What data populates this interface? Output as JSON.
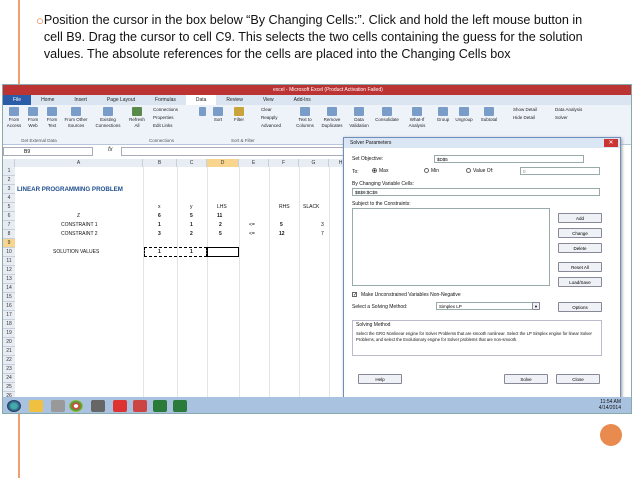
{
  "slide": {
    "bullet_text": "Position the cursor in the box below “By Changing Cells:”. Click and hold the left mouse button in cell B9. Drag the cursor to cell C9. This selects the two cells containing the guess for the solution values. The absolute references for the cells are placed into the Changing Cells box",
    "page_number": "",
    "accent_color": "#e98a4e"
  },
  "excel": {
    "title": "excel - Microsoft Excel (Product Activation Failed)",
    "tabs": [
      "File",
      "Home",
      "Insert",
      "Page Layout",
      "Formulas",
      "Data",
      "Review",
      "View",
      "Add-Ins"
    ],
    "ribbon": {
      "from_access": "From Access",
      "from_web": "From Web",
      "from_text": "From Text",
      "from_other": "From Other Sources",
      "existing": "Existing Connections",
      "refresh": "Refresh All",
      "connections": "Connections",
      "properties": "Properties",
      "edit_links": "Edit Links",
      "sort": "Sort",
      "filter": "Filter",
      "clear": "Clear",
      "reapply": "Reapply",
      "advanced": "Advanced",
      "text_to_columns": "Text to Columns",
      "remove_duplicates": "Remove Duplicates",
      "data_validation": "Data Validation",
      "consolidate": "Consolidate",
      "what_if": "What-If Analysis",
      "group": "Group",
      "ungroup": "Ungroup",
      "subtotal": "Subtotal",
      "show_detail": "Show Detail",
      "hide_detail": "Hide Detail",
      "data_analysis": "Data Analysis",
      "solver": "Solver",
      "grp_external": "Get External Data",
      "grp_connections": "Connections",
      "grp_sort": "Sort & Filter"
    },
    "name_box": "B9",
    "fx": "fx",
    "columns": [
      "A",
      "B",
      "C",
      "D",
      "E",
      "F",
      "G",
      "H"
    ],
    "rows": [
      "1",
      "2",
      "3",
      "4",
      "5",
      "6",
      "7",
      "8",
      "9",
      "10",
      "11",
      "12",
      "13",
      "14",
      "15",
      "16",
      "17",
      "18",
      "19",
      "20",
      "21",
      "22",
      "23",
      "24",
      "25",
      "26"
    ],
    "cells": {
      "title": "LINEAR PROGRAMMING PROBLEM",
      "x": "x",
      "y": "y",
      "lhs": "LHS",
      "rhs": "RHS",
      "slack": "SLACK",
      "z": "Z",
      "z_x": "6",
      "z_y": "5",
      "z_lhs": "11",
      "c1": "CONSTRAINT 1",
      "c1_x": "1",
      "c1_y": "1",
      "c1_lhs": "2",
      "c1_op": "<=",
      "c1_rhs": "5",
      "c1_slack": "3",
      "c2": "CONSTRAINT 2",
      "c2_x": "3",
      "c2_y": "2",
      "c2_lhs": "5",
      "c2_op": "<=",
      "c2_rhs": "12",
      "c2_slack": "7",
      "sol": "SOLUTION VALUES",
      "sol_x": "1",
      "sol_y": "1"
    }
  },
  "solver": {
    "title": "Solver Parameters",
    "set_objective_label": "Set Objective:",
    "set_objective_value": "$D$5",
    "to_label": "To:",
    "max": "Max",
    "min": "Min",
    "value_of": "Value Of:",
    "value_of_value": "0",
    "changing_label": "By Changing Variable Cells:",
    "changing_value": "$B$9:$C$9",
    "constraints_label": "Subject to the Constraints:",
    "btn_add": "Add",
    "btn_change": "Change",
    "btn_delete": "Delete",
    "btn_reset": "Reset All",
    "btn_load": "Load/Save",
    "nonneg_label": "Make Unconstrained Variables Non-Negative",
    "method_label": "Select a Solving Method:",
    "method_value": "Simplex LP",
    "btn_options": "Options",
    "method_group": "Solving Method",
    "method_text": "Select the GRG Nonlinear engine for Solver Problems that are smooth nonlinear. Select the LP Simplex engine for linear Solver Problems, and select the Evolutionary engine for Solver problems that are non-smooth.",
    "btn_help": "Help",
    "btn_solve": "Solve",
    "btn_close": "Close"
  },
  "taskbar": {
    "time": "11:54 AM",
    "date": "4/14/2014"
  }
}
